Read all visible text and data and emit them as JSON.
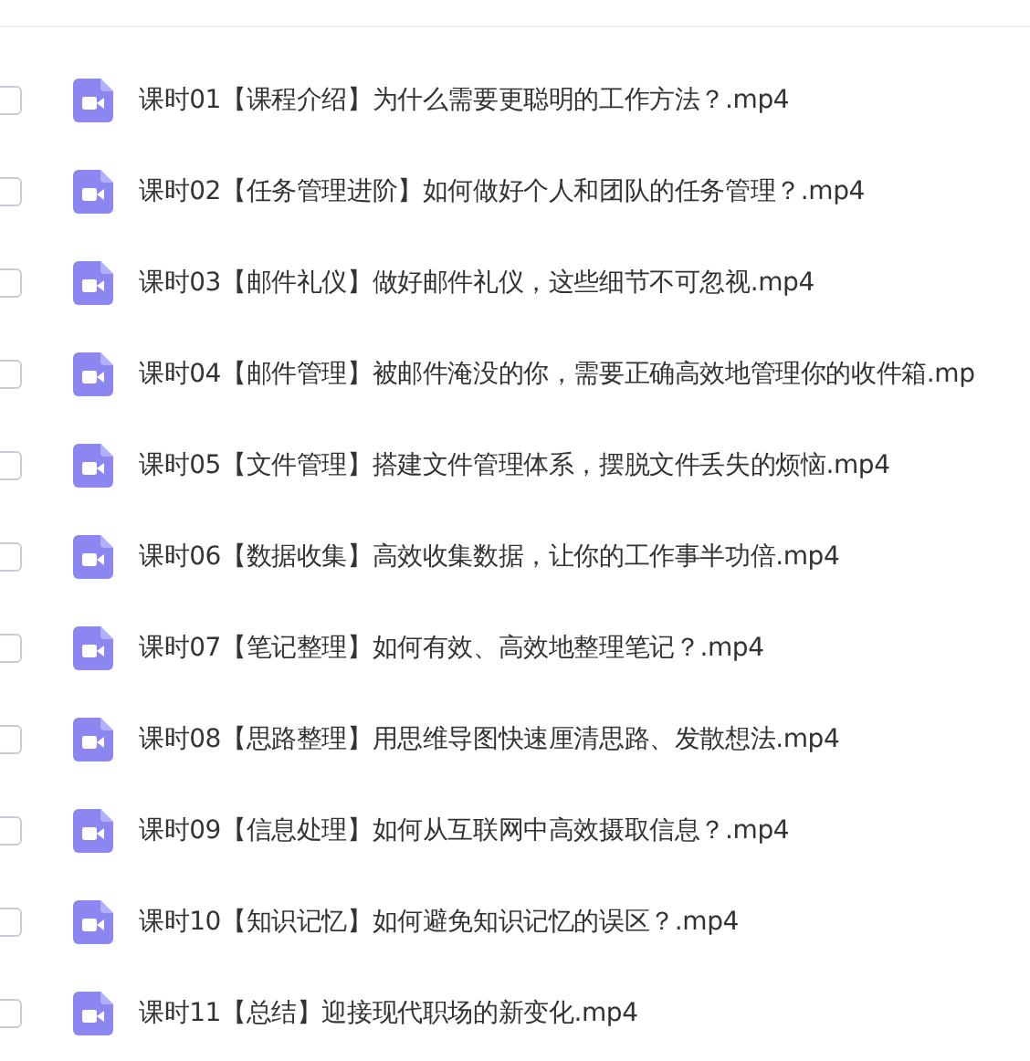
{
  "files": [
    {
      "name": "课时01【课程介绍】为什么需要更聪明的工作方法？.mp4",
      "checked": false
    },
    {
      "name": "课时02【任务管理进阶】如何做好个人和团队的任务管理？.mp4",
      "checked": false
    },
    {
      "name": "课时03【邮件礼仪】做好邮件礼仪，这些细节不可忽视.mp4",
      "checked": false
    },
    {
      "name": "课时04【邮件管理】被邮件淹没的你，需要正确高效地管理你的收件箱.mp",
      "checked": false
    },
    {
      "name": "课时05【文件管理】搭建文件管理体系，摆脱文件丢失的烦恼.mp4",
      "checked": false
    },
    {
      "name": "课时06【数据收集】高效收集数据，让你的工作事半功倍.mp4",
      "checked": false
    },
    {
      "name": "课时07【笔记整理】如何有效、高效地整理笔记？.mp4",
      "checked": false
    },
    {
      "name": "课时08【思路整理】用思维导图快速厘清思路、发散想法.mp4",
      "checked": false
    },
    {
      "name": "课时09【信息处理】如何从互联网中高效摄取信息？.mp4",
      "checked": false
    },
    {
      "name": "课时10【知识记忆】如何避免知识记忆的误区？.mp4",
      "checked": false
    },
    {
      "name": "课时11【总结】迎接现代职场的新变化.mp4",
      "checked": false
    }
  ]
}
